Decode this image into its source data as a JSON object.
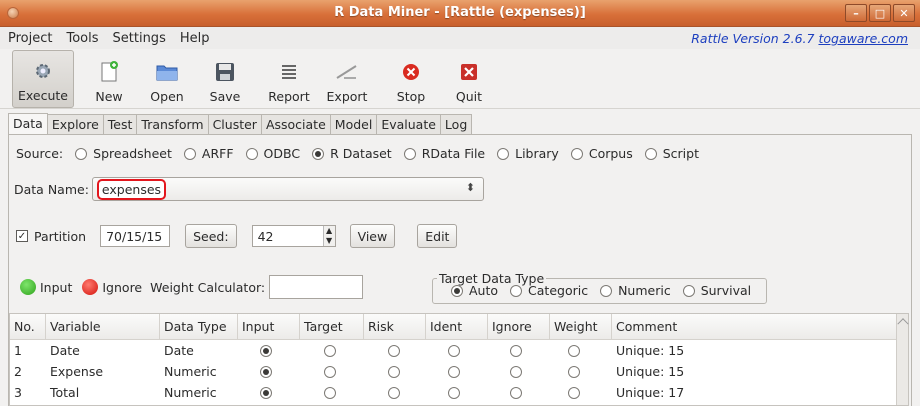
{
  "window": {
    "title": "R Data Miner - [Rattle (expenses)]"
  },
  "menu": {
    "items": [
      "Project",
      "Tools",
      "Settings",
      "Help"
    ],
    "version_prefix": "Rattle Version 2.6.7 ",
    "version_link": "togaware.com"
  },
  "toolbar": {
    "execute": "Execute",
    "new": "New",
    "open": "Open",
    "save": "Save",
    "report": "Report",
    "export": "Export",
    "stop": "Stop",
    "quit": "Quit"
  },
  "tabs": [
    "Data",
    "Explore",
    "Test",
    "Transform",
    "Cluster",
    "Associate",
    "Model",
    "Evaluate",
    "Log"
  ],
  "source": {
    "label": "Source:",
    "options": [
      "Spreadsheet",
      "ARFF",
      "ODBC",
      "R Dataset",
      "RData File",
      "Library",
      "Corpus",
      "Script"
    ],
    "selected": "R Dataset"
  },
  "data_name": {
    "label": "Data Name:",
    "value": "expenses"
  },
  "partition": {
    "label": "Partition",
    "checked": true,
    "value": "70/15/15",
    "seed_label": "Seed:",
    "seed_value": "42",
    "view": "View",
    "edit": "Edit"
  },
  "roles": {
    "input": "Input",
    "ignore": "Ignore",
    "weight_label": "Weight Calculator:",
    "weight_value": ""
  },
  "target_type": {
    "legend": "Target Data Type",
    "options": [
      "Auto",
      "Categoric",
      "Numeric",
      "Survival"
    ],
    "selected": "Auto"
  },
  "table": {
    "headers": [
      "No.",
      "Variable",
      "Data Type",
      "Input",
      "Target",
      "Risk",
      "Ident",
      "Ignore",
      "Weight",
      "Comment"
    ],
    "rows": [
      {
        "no": "1",
        "variable": "Date",
        "type": "Date",
        "role": "Input",
        "comment": "Unique: 15"
      },
      {
        "no": "2",
        "variable": "Expense",
        "type": "Numeric",
        "role": "Input",
        "comment": "Unique: 15"
      },
      {
        "no": "3",
        "variable": "Total",
        "type": "Numeric",
        "role": "Input",
        "comment": "Unique: 17"
      }
    ]
  },
  "colors": {
    "title_bar": "#d8703a",
    "highlight": "#e3161d",
    "input_dot": "#2fa11b",
    "ignore_dot": "#d3120b",
    "link": "#1d3fbf"
  }
}
